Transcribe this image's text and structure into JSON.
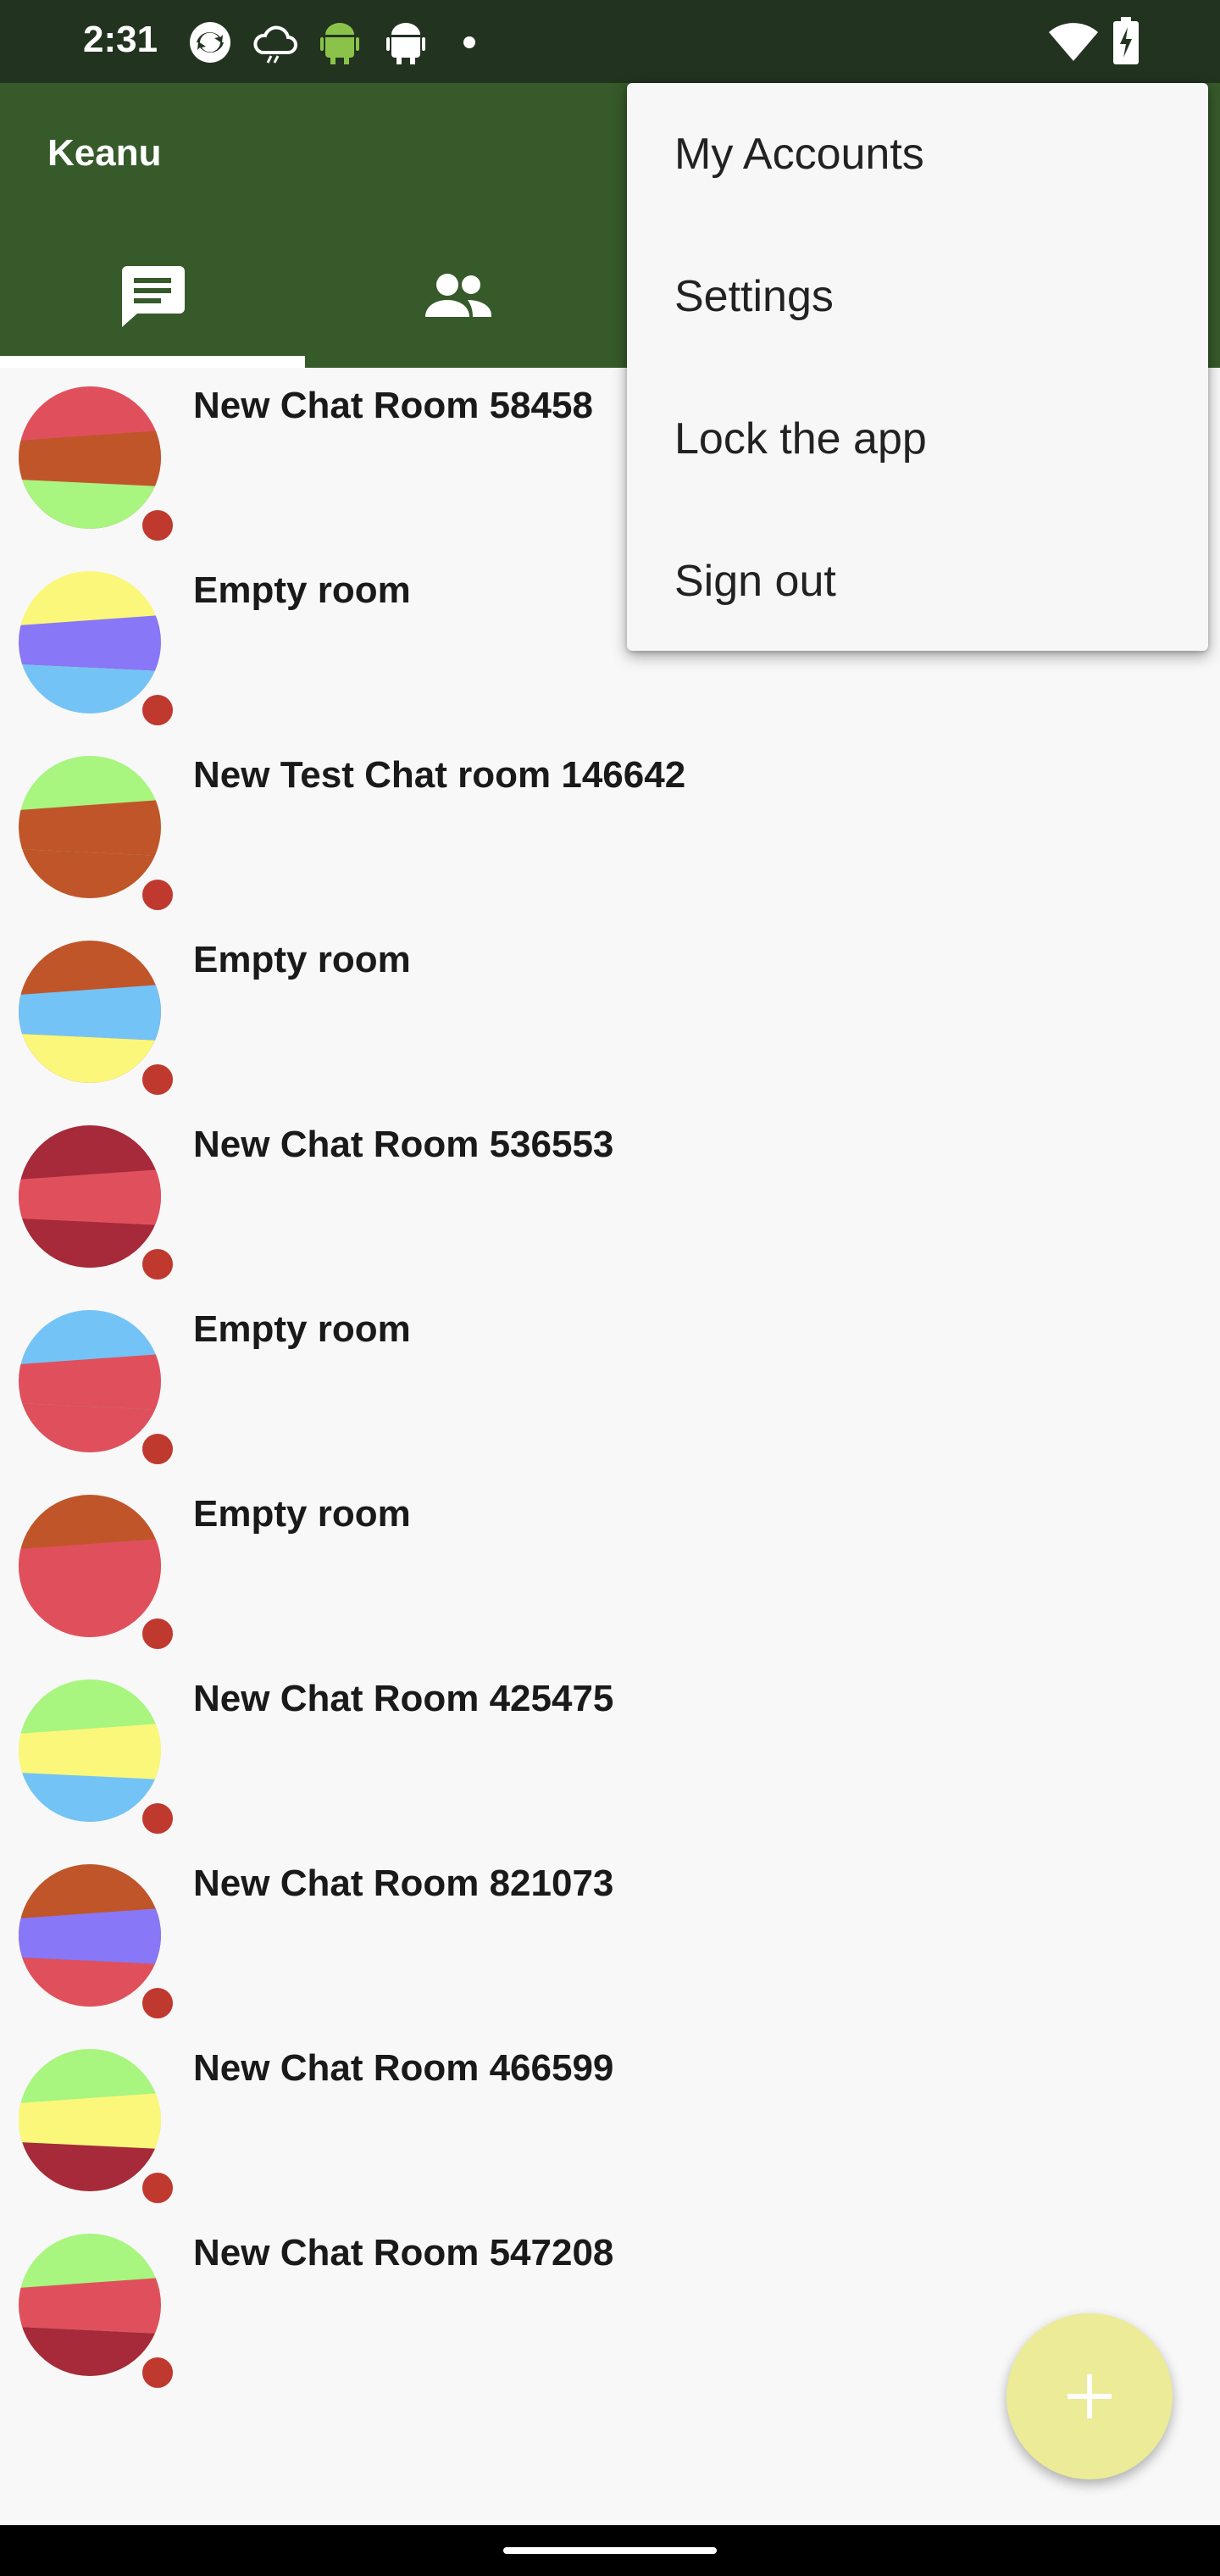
{
  "status_bar": {
    "time": "2:31",
    "icons": [
      "sync-icon",
      "cloud-icon",
      "android-icon",
      "android-debug-icon",
      "dot-icon",
      "wifi-icon",
      "battery-charging-icon"
    ]
  },
  "app_bar": {
    "title": "Keanu",
    "tabs": [
      {
        "icon": "chat-icon",
        "selected": true
      },
      {
        "icon": "contacts-icon",
        "selected": false
      }
    ]
  },
  "menu": {
    "items": [
      "My Accounts",
      "Settings",
      "Lock the app",
      "Sign out"
    ]
  },
  "rooms": [
    {
      "title": "New Chat Room 58458",
      "colors": [
        "#e0505c",
        "#c0552a",
        "#a8f57f"
      ]
    },
    {
      "title": "Empty room",
      "colors": [
        "#fbf77a",
        "#8877f6",
        "#74c3f6"
      ]
    },
    {
      "title": "New Test Chat room 146642",
      "colors": [
        "#a8f57f",
        "#c0552a",
        "#c0552a"
      ]
    },
    {
      "title": "Empty room",
      "colors": [
        "#c0552a",
        "#74c3f6",
        "#fbf77a"
      ]
    },
    {
      "title": "New Chat Room 536553",
      "colors": [
        "#a62a3a",
        "#e0505c",
        "#a62a3a"
      ]
    },
    {
      "title": "Empty room",
      "colors": [
        "#74c3f6",
        "#e0505c",
        "#e0505c"
      ]
    },
    {
      "title": "Empty room",
      "colors": [
        "#c0552a",
        "#e0505c",
        "#e0505c"
      ]
    },
    {
      "title": "New Chat Room 425475",
      "colors": [
        "#a8f57f",
        "#fbf77a",
        "#74c3f6"
      ]
    },
    {
      "title": "New Chat Room 821073",
      "colors": [
        "#c0552a",
        "#8877f6",
        "#e0505c"
      ]
    },
    {
      "title": "New Chat Room 466599",
      "colors": [
        "#a8f57f",
        "#fbf77a",
        "#a62a3a"
      ]
    },
    {
      "title": "New Chat Room 547208",
      "colors": [
        "#a8f57f",
        "#e0505c",
        "#a62a3a"
      ]
    }
  ],
  "fab": {
    "icon": "plus-icon"
  },
  "colors": {
    "status_bar": "#223320",
    "app_bar": "#365a2a",
    "fab": "#eceb97",
    "badge": "#c0392e"
  }
}
